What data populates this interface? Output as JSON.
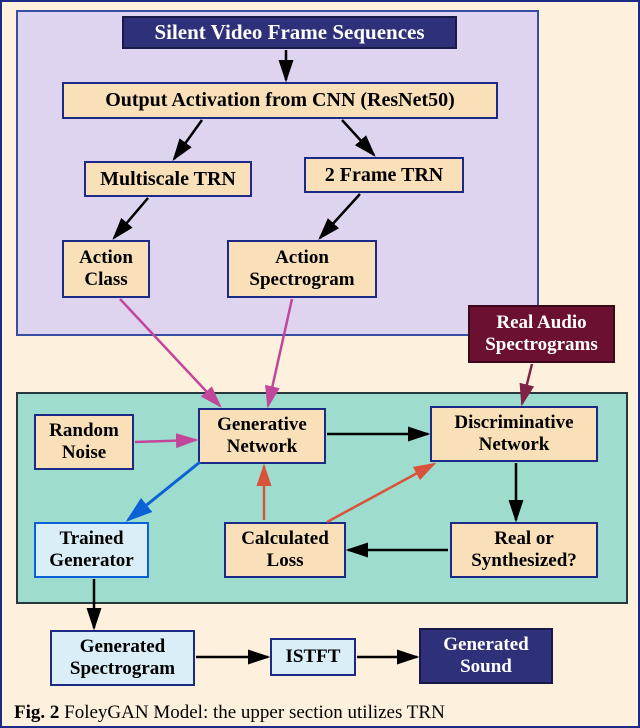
{
  "boxes": {
    "title": "Silent Video Frame Sequences",
    "cnn": "Output Activation from CNN (ResNet50)",
    "multiscale": "Multiscale TRN",
    "frame2": "2 Frame TRN",
    "action_class": "Action Class",
    "action_spec": "Action Spectrogram",
    "real_audio": "Real Audio Spectrograms",
    "random_noise": "Random Noise",
    "generative": "Generative Network",
    "discriminative": "Discriminative Network",
    "trained_gen": "Trained Generator",
    "calc_loss": "Calculated Loss",
    "real_or": "Real or Synthesized?",
    "gen_spec": "Generated Spectrogram",
    "istft": "ISTFT",
    "gen_sound": "Generated Sound"
  },
  "caption_prefix": "Fig. 2",
  "caption_rest": " FoleyGAN Model: the upper section utilizes TRN"
}
